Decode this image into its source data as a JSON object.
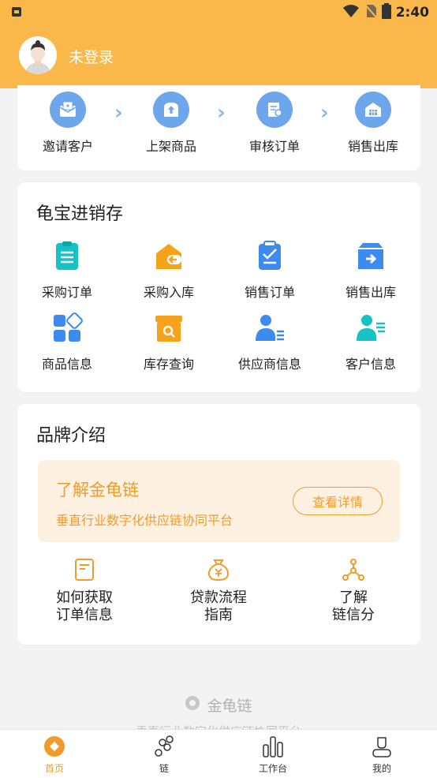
{
  "status_bar": {
    "time": "2:40"
  },
  "header": {
    "login_text": "未登录"
  },
  "steps": [
    {
      "label": "邀请客户",
      "icon": "mail-icon"
    },
    {
      "label": "上架商品",
      "icon": "shelf-upload-icon"
    },
    {
      "label": "审核订单",
      "icon": "review-order-icon"
    },
    {
      "label": "销售出库",
      "icon": "warehouse-icon"
    }
  ],
  "inventory": {
    "title": "龟宝进销存",
    "items": [
      {
        "label": "采购订单",
        "icon": "clipboard-icon",
        "color": "#15c2c6"
      },
      {
        "label": "采购入库",
        "icon": "stock-in-icon",
        "color": "#f7a21b"
      },
      {
        "label": "销售订单",
        "icon": "sales-order-icon",
        "color": "#3d8bf0"
      },
      {
        "label": "销售出库",
        "icon": "stock-out-icon",
        "color": "#3d8bf0"
      },
      {
        "label": "商品信息",
        "icon": "apps-icon",
        "color": "#3d8bf0"
      },
      {
        "label": "库存查询",
        "icon": "stock-search-icon",
        "color": "#f7a21b"
      },
      {
        "label": "供应商信息",
        "icon": "supplier-icon",
        "color": "#3d8bf0"
      },
      {
        "label": "客户信息",
        "icon": "customer-icon",
        "color": "#15c2c6"
      }
    ]
  },
  "brand": {
    "title": "品牌介绍",
    "promo_title": "了解金龟链",
    "promo_subtitle": "垂直行业数字化供应链协同平台",
    "promo_button": "查看详情",
    "info_items": [
      {
        "line1": "如何获取",
        "line2": "订单信息",
        "icon": "document-icon"
      },
      {
        "line1": "贷款流程",
        "line2": "指南",
        "icon": "money-bag-icon"
      },
      {
        "line1": "了解",
        "line2": "链信分",
        "icon": "network-icon"
      }
    ]
  },
  "footer": {
    "brand": "金龟链",
    "subtitle": "垂直行业数字化供应链协同平台"
  },
  "tabs": [
    {
      "label": "首页",
      "icon": "home-icon"
    },
    {
      "label": "链",
      "icon": "chain-icon"
    },
    {
      "label": "工作台",
      "icon": "chart-icon"
    },
    {
      "label": "我的",
      "icon": "profile-icon"
    }
  ],
  "colors": {
    "accent": "#fbb84a",
    "orange_text": "#f39b2a",
    "step_blue": "#6ea6ec"
  }
}
